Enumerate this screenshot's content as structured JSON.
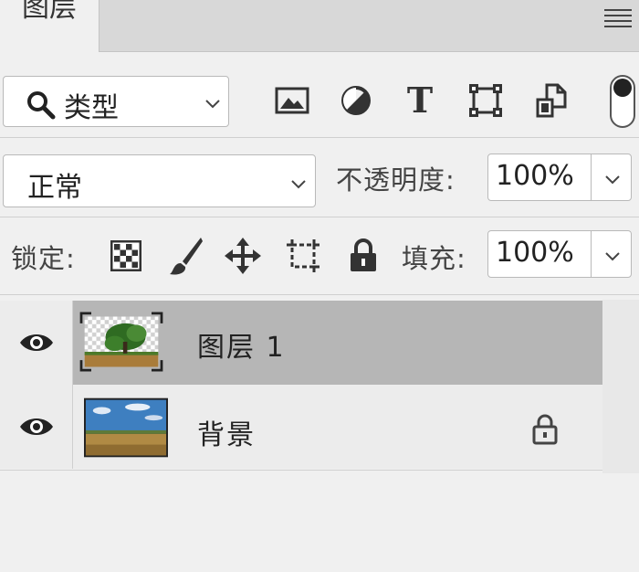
{
  "tabs": {
    "active_label": "图层"
  },
  "filter": {
    "kind_label": "类型",
    "icons": [
      "image-filter-icon",
      "adjustment-filter-icon",
      "type-filter-icon",
      "shape-filter-icon",
      "smart-object-filter-icon"
    ],
    "type_glyph": "T"
  },
  "blend": {
    "mode_label": "正常"
  },
  "opacity": {
    "label": "不透明度:",
    "value": "100%"
  },
  "lock": {
    "label": "锁定:",
    "icons": [
      "lock-transparent-icon",
      "lock-image-icon",
      "lock-position-icon",
      "lock-artboard-icon",
      "lock-all-icon"
    ]
  },
  "fill": {
    "label": "填充:",
    "value": "100%"
  },
  "layers": [
    {
      "name": "图层 1",
      "selected": true,
      "visible": true,
      "locked": false
    },
    {
      "name": "背景",
      "selected": false,
      "visible": true,
      "locked": true
    }
  ],
  "colors": {
    "selected_row": "#b6b6b6",
    "panel_bg": "#f0f0f0",
    "tab_bar": "#d8d8d8"
  }
}
